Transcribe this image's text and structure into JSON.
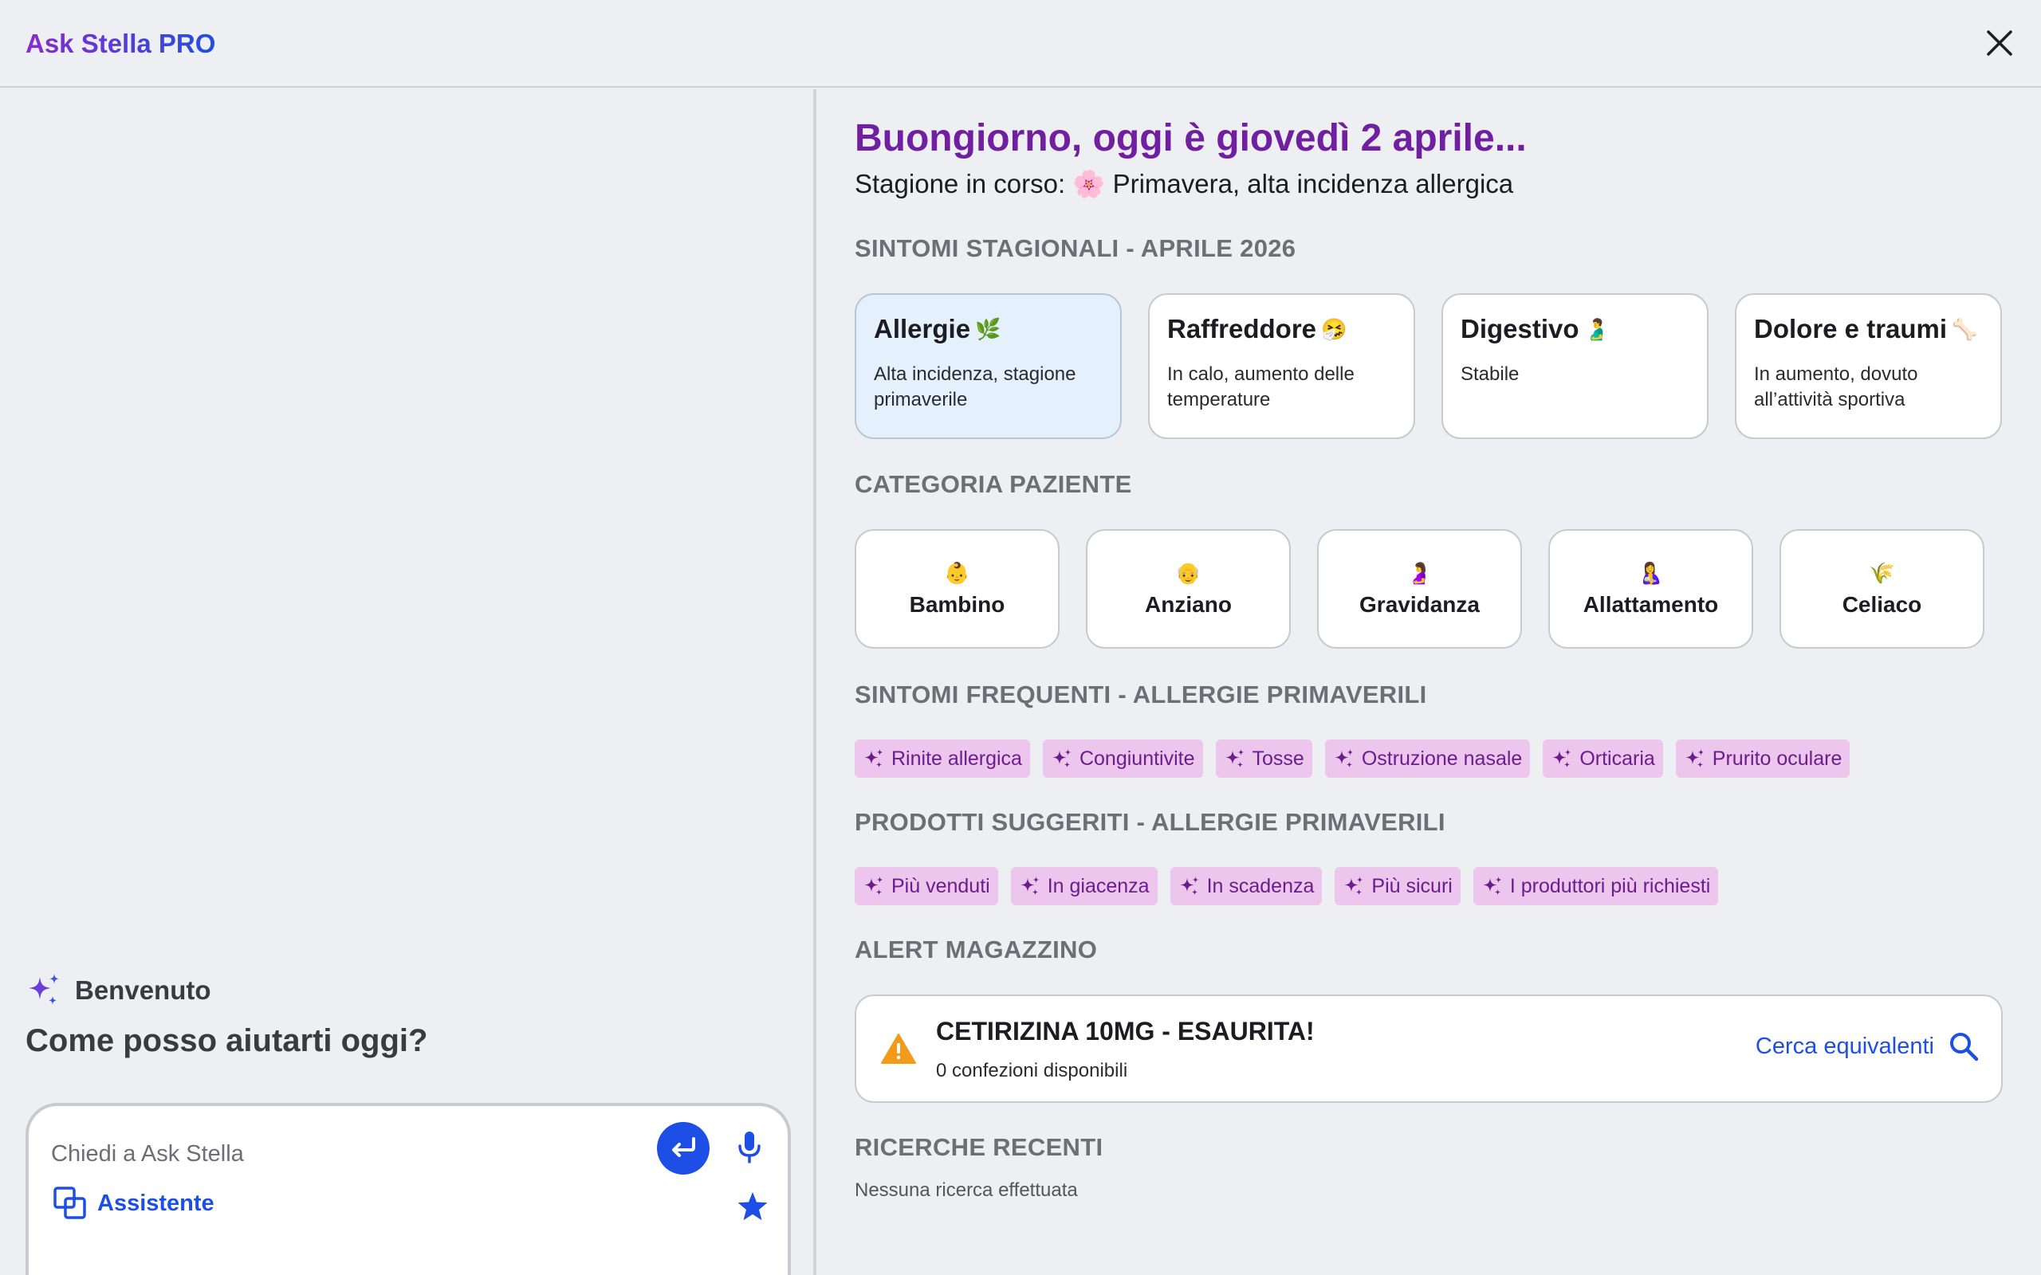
{
  "header": {
    "brand": "Ask Stella PRO"
  },
  "left": {
    "welcome": "Benvenuto",
    "question": "Come posso aiutarti oggi?",
    "input_placeholder": "Chiedi a Ask Stella",
    "assistant_label": "Assistente"
  },
  "main": {
    "greeting": "Buongiorno, oggi è giovedì 2 aprile...",
    "season": "Stagione in corso: 🌸 Primavera, alta incidenza allergica",
    "sections": {
      "seasonal": "SINTOMI STAGIONALI - APRILE 2026",
      "patient": "CATEGORIA PAZIENTE",
      "frequent": "SINTOMI FREQUENTI - ALLERGIE PRIMAVERILI",
      "products": "PRODOTTI SUGGERITI - ALLERGIE PRIMAVERILI",
      "alerts": "ALERT MAGAZZINO",
      "recent": "RICERCHE RECENTI"
    },
    "seasonal_cards": [
      {
        "title": "Allergie",
        "emoji": "🌿",
        "desc": "Alta incidenza, stagione primaverile"
      },
      {
        "title": "Raffreddore",
        "emoji": "🤧",
        "desc": "In calo, aumento delle temperature"
      },
      {
        "title": "Digestivo",
        "emoji": "🫃",
        "desc": "Stabile"
      },
      {
        "title": "Dolore e traumi",
        "emoji": "🦴",
        "desc": "In aumento, dovuto all’attività sportiva"
      }
    ],
    "patient_categories": [
      {
        "label": "Bambino",
        "emoji": "👶"
      },
      {
        "label": "Anziano",
        "emoji": "👴"
      },
      {
        "label": "Gravidanza",
        "emoji": "🤰"
      },
      {
        "label": "Allattamento",
        "emoji": "🤱"
      },
      {
        "label": "Celiaco",
        "emoji": "🌾"
      }
    ],
    "frequent_symptoms": [
      "Rinite allergica",
      "Congiuntivite",
      "Tosse",
      "Ostruzione nasale",
      "Orticaria",
      "Prurito oculare"
    ],
    "suggested_products": [
      "Più venduti",
      "In giacenza",
      "In scadenza",
      "Più sicuri",
      "I produttori più richiesti"
    ],
    "alert": {
      "title": "CETIRIZINA 10MG - ESAURITA!",
      "subtitle": "0 confezioni disponibili",
      "action": "Cerca equivalenti"
    },
    "recent_empty": "Nessuna ricerca effettuata"
  },
  "colors": {
    "accent_purple": "#6f1fa0",
    "accent_blue": "#1d4fe6",
    "chip_bg": "#ecc6ec",
    "warning": "#f29a1a"
  }
}
